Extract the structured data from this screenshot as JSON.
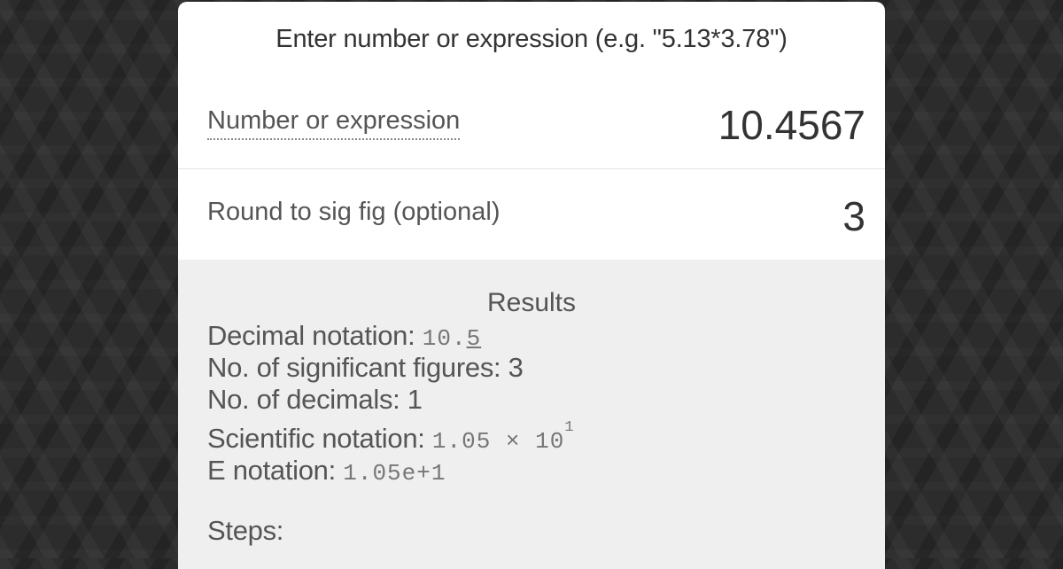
{
  "prompt": "Enter number or expression (e.g. \"5.13*3.78\")",
  "fields": {
    "number": {
      "label": "Number or expression",
      "value": "10.4567"
    },
    "sigfig": {
      "label": "Round to sig fig (optional)",
      "value": "3"
    }
  },
  "results": {
    "title": "Results",
    "decimal": {
      "label": "Decimal notation:",
      "value_prefix": "10.",
      "value_underlined": "5"
    },
    "sig_figs": {
      "label": "No. of significant figures:",
      "value": "3"
    },
    "decimals": {
      "label": "No. of decimals:",
      "value": "1"
    },
    "scientific": {
      "label": "Scientific notation:",
      "mantissa": "1.05 × 10",
      "exponent": "1"
    },
    "e_notation": {
      "label": "E notation:",
      "value": "1.05e+1"
    },
    "steps_label": "Steps:"
  }
}
